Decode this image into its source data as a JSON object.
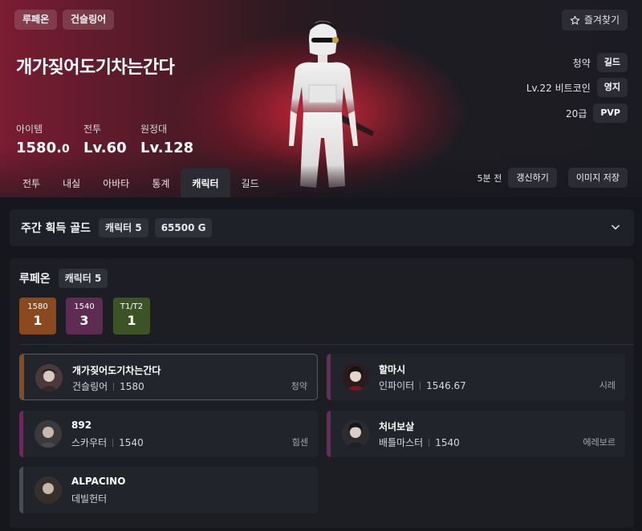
{
  "header": {
    "tags": [
      "루페온",
      "건슬링어"
    ],
    "character_name": "개가짖어도기차는간다",
    "favorite_label": "즐겨찾기",
    "favorite_icon": "star-outline-icon",
    "stats": [
      {
        "label": "아이템",
        "value": "1580.0"
      },
      {
        "label": "전투",
        "value": "Lv.60"
      },
      {
        "label": "원정대",
        "value": "Lv.128"
      }
    ],
    "info": [
      {
        "text": "청약",
        "pill": "길드"
      },
      {
        "text": "Lv.22 비트코인",
        "pill": "영지"
      },
      {
        "text": "20급",
        "pill": "PVP"
      }
    ],
    "tabs": [
      "전투",
      "내실",
      "아바타",
      "통계",
      "캐릭터",
      "길드"
    ],
    "active_tab": "캐릭터",
    "updated_ago": "5분 전",
    "refresh_label": "갱신하기",
    "save_image_label": "이미지 저장"
  },
  "weekly_gold": {
    "title": "주간 획득 골드",
    "character_count": "캐릭터 5",
    "gold": "65500 G"
  },
  "server": {
    "name": "루페온",
    "character_count": "캐릭터 5",
    "tiers": [
      {
        "label": "1580",
        "count": "1",
        "color": "#8a4a1e"
      },
      {
        "label": "1540",
        "count": "3",
        "color": "#5e2b55"
      },
      {
        "label": "T1/T2",
        "count": "1",
        "color": "#3c5326"
      }
    ],
    "characters": [
      {
        "name": "개가짖어도기차는간다",
        "class": "건슬링어",
        "level": "1580",
        "guild": "청약",
        "accent": "#8a4a1e",
        "selected": true
      },
      {
        "name": "할마시",
        "class": "인파이터",
        "level": "1546.67",
        "guild": "시레",
        "accent": "#6b2a5e",
        "selected": false
      },
      {
        "name": "892",
        "class": "스카우터",
        "level": "1540",
        "guild": "힘센",
        "accent": "#6b2a5e",
        "selected": false
      },
      {
        "name": "처녀보살",
        "class": "배틀마스터",
        "level": "1540",
        "guild": "에레보르",
        "accent": "#6b2a5e",
        "selected": false
      },
      {
        "name": "ALPACINO",
        "class": "데빌헌터",
        "level": "",
        "guild": "",
        "accent": "#4a4c55",
        "selected": false
      }
    ]
  }
}
